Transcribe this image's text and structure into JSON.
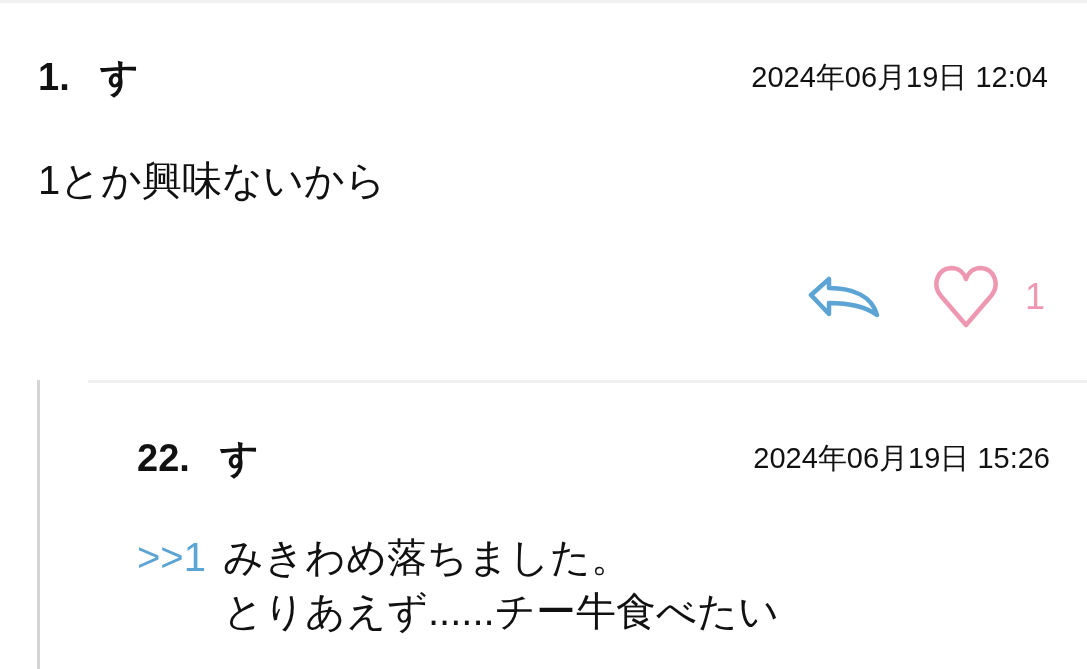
{
  "post": {
    "number": "1.",
    "author": "す",
    "date": "2024年06月19日 12:04",
    "body": "1とか興味ないから",
    "like_count": "1"
  },
  "replies": [
    {
      "number": "22.",
      "author": "す",
      "date": "2024年06月19日 15:26",
      "anchor": ">>1",
      "body_lines": [
        "みきわめ落ちました。",
        "とりあえず......チー牛食べたい"
      ]
    }
  ]
}
